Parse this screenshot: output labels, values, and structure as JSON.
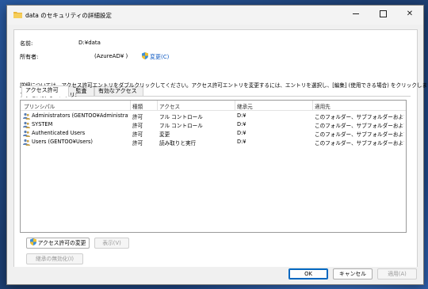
{
  "window": {
    "title": "data のセキュリティの詳細設定",
    "controls": {
      "minimize": "minimize-icon",
      "maximize": "maximize-icon",
      "close": "close-icon"
    }
  },
  "fields": {
    "name_label": "名前:",
    "name_value": "D:¥data",
    "owner_label": "所有者:",
    "owner_value": "(AzureAD¥          )",
    "change_link": "変更(C)"
  },
  "tabs": [
    {
      "label": "アクセス許可",
      "active": true
    },
    {
      "label": "監査",
      "active": false
    },
    {
      "label": "有効なアクセス",
      "active": false
    }
  ],
  "description": "詳細については、アクセス許可エントリをダブルクリックしてください。アクセス許可エントリを変更するには、エントリを選択し、[編集] (使用できる場合) をクリックします。",
  "list_label": "アクセス許可エントリ:",
  "columns": {
    "principal": "プリンシパル",
    "type": "種類",
    "access": "アクセス",
    "inherited_from": "継承元",
    "applies_to": "適用先"
  },
  "rows": [
    {
      "principal": "Administrators (GENTOO¥Administrat...",
      "type": "許可",
      "access": "フル コントロール",
      "inherited_from": "D:¥",
      "applies_to": "このフォルダー、サブフォルダーおよびファイル"
    },
    {
      "principal": "SYSTEM",
      "type": "許可",
      "access": "フル コントロール",
      "inherited_from": "D:¥",
      "applies_to": "このフォルダー、サブフォルダーおよびファイル"
    },
    {
      "principal": "Authenticated Users",
      "type": "許可",
      "access": "変更",
      "inherited_from": "D:¥",
      "applies_to": "このフォルダー、サブフォルダーおよびファイル"
    },
    {
      "principal": "Users (GENTOO¥Users)",
      "type": "許可",
      "access": "読み取りと実行",
      "inherited_from": "D:¥",
      "applies_to": "このフォルダー、サブフォルダーおよびファイル"
    }
  ],
  "buttons": {
    "change_permissions": "アクセス許可の変更",
    "view": "表示(V)",
    "disable_inheritance": "継承の無効化(I)",
    "ok": "OK",
    "cancel": "キャンセル",
    "apply": "適用(A)"
  },
  "colors": {
    "accent": "#0067c0",
    "link": "#0a57c2",
    "desktop": "#1d3f73"
  }
}
